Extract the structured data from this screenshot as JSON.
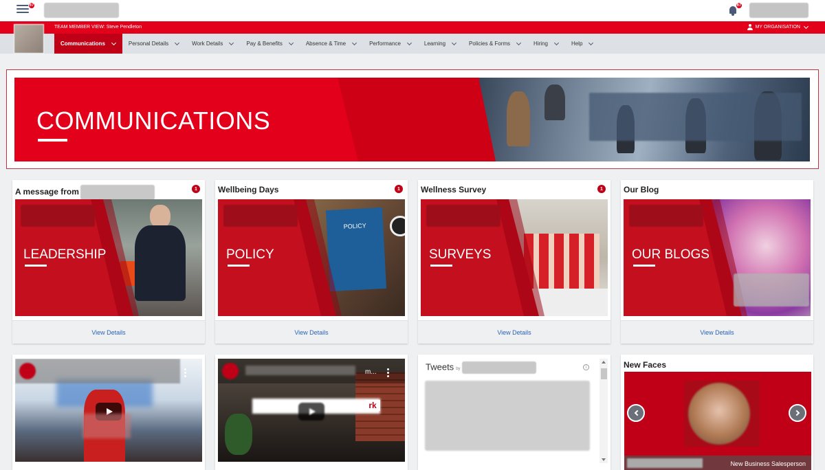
{
  "header": {
    "menu_badge": "67",
    "bell_badge": "67"
  },
  "top_bar": {
    "team_member_view": "TEAM MEMBER VIEW: Steve Pendleton",
    "my_organisation": "MY ORGANISATION"
  },
  "nav": {
    "items": [
      {
        "label": "Communications"
      },
      {
        "label": "Personal Details"
      },
      {
        "label": "Work Details"
      },
      {
        "label": "Pay & Benefits"
      },
      {
        "label": "Absence & Time"
      },
      {
        "label": "Performance"
      },
      {
        "label": "Learning"
      },
      {
        "label": "Policies & Forms"
      },
      {
        "label": "Hiring"
      },
      {
        "label": "Help"
      }
    ]
  },
  "hero": {
    "title": "COMMUNICATIONS"
  },
  "cards": [
    {
      "title": "A message from",
      "badge": "1",
      "image_label": "LEADERSHIP",
      "link": "View Details"
    },
    {
      "title": "Wellbeing Days",
      "badge": "1",
      "image_label": "POLICY",
      "inner_text": "POLICY",
      "link": "View Details"
    },
    {
      "title": "Wellness Survey",
      "badge": "1",
      "image_label": "SURVEYS",
      "link": "View Details"
    },
    {
      "title": "Our Blog",
      "image_label": "OUR BLOGS",
      "link": "View Details"
    }
  ],
  "video2": {
    "title_fragment": "m...",
    "sign_text": "rk"
  },
  "tweets": {
    "title": "Tweets",
    "by": "by",
    "info": "i"
  },
  "new_faces": {
    "title": "New Faces",
    "caption": "New Business Salesperson"
  },
  "colors": {
    "brand_red": "#e2001a",
    "dark_red": "#c00016",
    "link_blue": "#2a63b5"
  }
}
